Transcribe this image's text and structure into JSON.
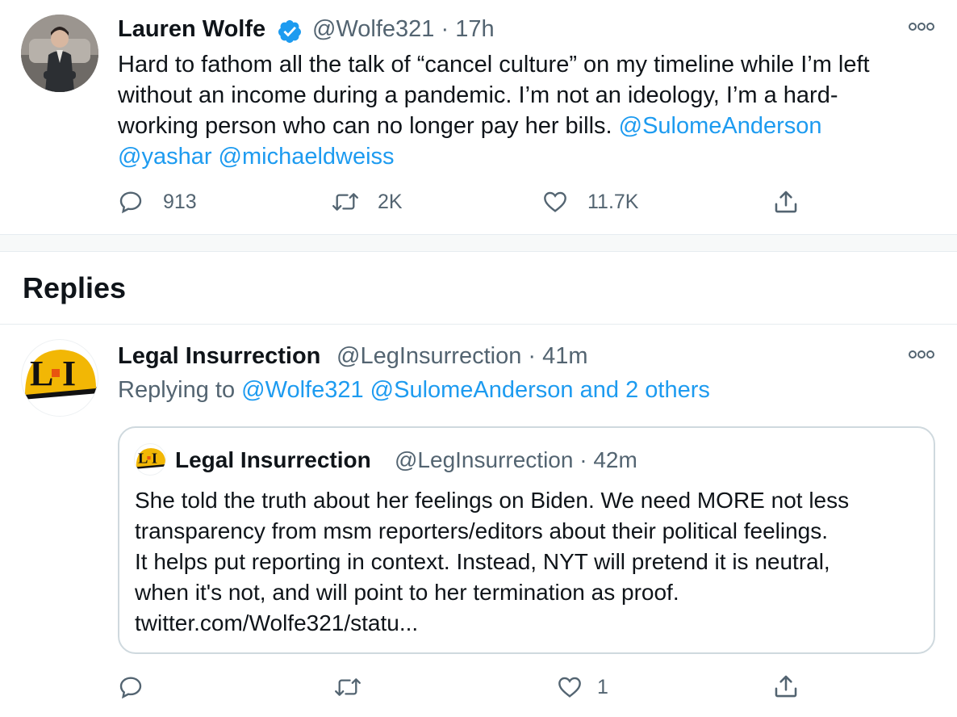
{
  "tweet": {
    "author_name": "Lauren Wolfe",
    "handle": "@Wolfe321",
    "separator": "·",
    "time": "17h",
    "text_line1": "Hard to fathom all the talk of “cancel culture” on my timeline while I’m left",
    "text_line2": "without an income during a pandemic. I’m not an ideology, I’m a hard-",
    "text_line3_plain": "working person who can no longer pay her bills. ",
    "mention1": "@SulomeAnderson",
    "mention2": "@yashar",
    "mention3": "@michaeldweiss",
    "reply_count": "913",
    "retweet_count": "2K",
    "like_count": "11.7K",
    "more_icon": "more-dots-icon",
    "verified_icon": "verified-badge-icon"
  },
  "replies_heading": "Replies",
  "reply": {
    "author_name": "Legal Insurrection",
    "handle": "@LegInsurrection",
    "separator": "·",
    "time": "41m",
    "replying_prefix": "Replying to ",
    "replying_mention1": "@Wolfe321",
    "replying_mention2": "@SulomeAnderson",
    "replying_others": "and 2 others",
    "like_count": "1",
    "quote": {
      "author_name": "Legal Insurrection",
      "handle": "@LegInsurrection",
      "separator": "·",
      "time": "42m",
      "line1": "She told the truth about her feelings on Biden. We need MORE not less",
      "line2": "transparency from msm reporters/editors about their political feelings.",
      "line3": "It helps put reporting in context. Instead, NYT will pretend it is neutral,",
      "line4": "when it's not, and will point to her termination as proof.",
      "line5": "twitter.com/Wolfe321/statu..."
    }
  },
  "avatar_logo_text": "LI",
  "colors": {
    "link": "#1d9bf0",
    "grey": "#536471",
    "logo_yellow": "#f2b705"
  }
}
